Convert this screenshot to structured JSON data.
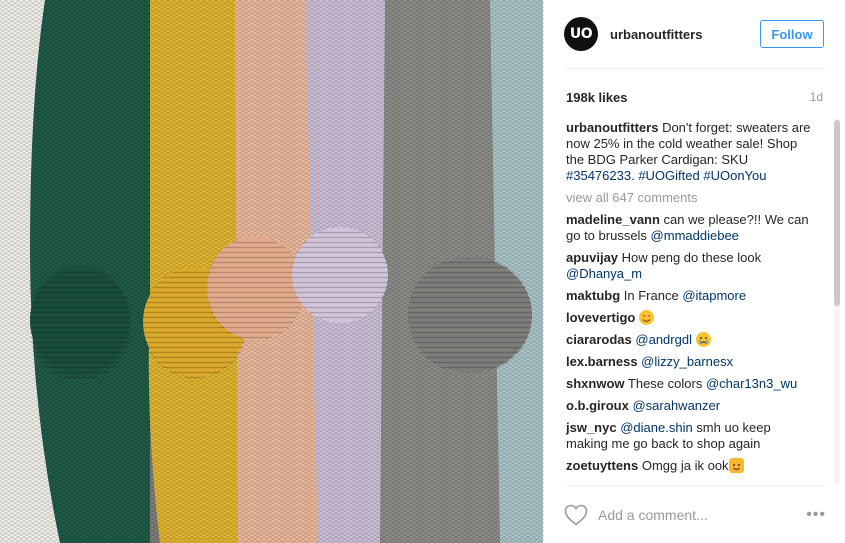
{
  "post": {
    "image_alt": "Row of knitted sweaters in white, green, mustard, peach, lavender, grey and blue",
    "colors": [
      "#f0efe9",
      "#1f5a47",
      "#e0b431",
      "#eab89c",
      "#cbbfd6",
      "#8a8a86",
      "#a9c4c8"
    ]
  },
  "header": {
    "avatar_text": "UO",
    "username": "urbanoutfitters",
    "follow_label": "Follow"
  },
  "stats": {
    "likes": "198k likes",
    "time": "1d"
  },
  "caption": {
    "user": "urbanoutfitters",
    "text": " Don't forget: sweaters are now 25% in the cold weather sale! Shop the BDG Parker Cardigan: SKU ",
    "tags": [
      "#35476233.",
      "#UOGifted",
      "#UOonYou"
    ]
  },
  "view_all": "view all 647 comments",
  "comments": [
    {
      "user": "madeline_vann",
      "text": " can we please?!! We can go to brussels ",
      "tag": "@mmaddiebee",
      "after": ""
    },
    {
      "user": "apuvijay",
      "text": " How peng do these look ",
      "tag": "@Dhanya_m",
      "after": ""
    },
    {
      "user": "maktubg",
      "text": " In France ",
      "tag": "@itapmore",
      "after": ""
    },
    {
      "user": "lovevertigo",
      "text": " ",
      "tag": "",
      "after": "",
      "emoji": "heart-eyes-emoji"
    },
    {
      "user": "ciararodas",
      "text": " ",
      "tag": "@andrgdl",
      "after": " ",
      "emoji": "crying-emoji"
    },
    {
      "user": "lex.barness",
      "text": " ",
      "tag": "@lizzy_barnesx",
      "after": ""
    },
    {
      "user": "shxnwow",
      "text": " These colors ",
      "tag": "@char13n3_wu",
      "after": ""
    },
    {
      "user": "o.b.giroux",
      "text": " ",
      "tag": "@sarahwanzer",
      "after": ""
    },
    {
      "user": "jsw_nyc",
      "text": " ",
      "tag": "@diane.shin",
      "after": " smh uo keep making me go back to shop again"
    },
    {
      "user": "zoetuyttens",
      "text": " Omgg ja ik ook",
      "tag": "",
      "after": "",
      "emoji": "cat-emoji"
    }
  ],
  "comment_box": {
    "placeholder": "Add a comment...",
    "more": "•••"
  }
}
